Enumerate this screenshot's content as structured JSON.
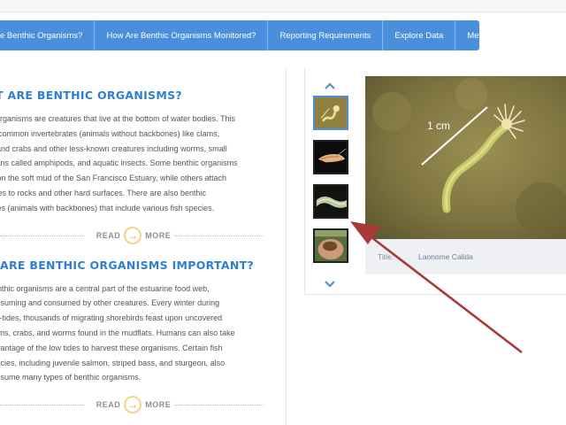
{
  "nav": {
    "items": [
      "e Benthic Organisms?",
      "How Are Benthic Organisms Monitored?",
      "Reporting Requirements",
      "Explore Data",
      "Metadata"
    ]
  },
  "sections": [
    {
      "title": "AT ARE BENTHIC ORGANISMS?",
      "lines": [
        "ic organisms are creatures that live at the bottom of water bodies. This",
        "es common invertebrates (animals without backbones) like clams,",
        "p, and crabs and other less-known creatures including worms, small",
        "ceans called amphipods, and aquatic insects. Some benthic organisms",
        "or on the soft mud of the San Francisco Estuary, while others attach",
        "elves to rocks and other hard surfaces. There are also benthic",
        "rates (animals with backbones) that include various fish species."
      ],
      "readmore": {
        "read": "READ",
        "more": "MORE"
      }
    },
    {
      "title": "Y ARE BENTHIC ORGANISMS IMPORTANT?",
      "lines": [
        "Benthic organisms are a central part of the estuarine food web,",
        "consuming and consumed by other creatures. Every winter during",
        "low-tides, thousands of migrating shorebirds feast upon uncovered",
        "clams, crabs, and worms found in the mudflats. Humans can also take",
        "advantage of the low tides to harvest these organisms. Certain fish",
        "species, including juvenile salmon, striped bass, and sturgeon, also",
        "consume many types of benthic organisms."
      ],
      "readmore": {
        "read": "READ",
        "more": "MORE"
      }
    }
  ],
  "gallery": {
    "up_icon": "chevron-up-icon",
    "down_icon": "chevron-down-icon",
    "thumbnails": [
      {
        "name": "thumb-anemone",
        "active": true
      },
      {
        "name": "thumb-shrimp",
        "active": false
      },
      {
        "name": "thumb-worm",
        "active": false
      },
      {
        "name": "thumb-hand-specimen",
        "active": false
      }
    ],
    "photo": {
      "scale_label": "1 cm"
    },
    "caption": {
      "label": "Title:",
      "value": "Laonome Calida"
    }
  },
  "colors": {
    "nav_bg": "#4a8fdc",
    "title_blue": "#2e7fd1",
    "arrow_red": "#a83a3a",
    "readmore_arrow": "#e5a128"
  }
}
